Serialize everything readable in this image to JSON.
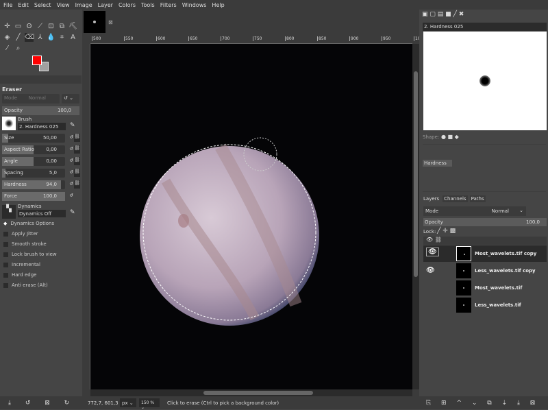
{
  "menu": [
    "File",
    "Edit",
    "Select",
    "View",
    "Image",
    "Layer",
    "Colors",
    "Tools",
    "Filters",
    "Windows",
    "Help"
  ],
  "colors": {
    "fg": "#ff0000",
    "bg": "#a0a0a0"
  },
  "tool_options": {
    "title": "Eraser",
    "mode_label": "Mode",
    "mode_value": "Normal",
    "opacity": {
      "label": "Opacity",
      "value": "100,0",
      "fraction": 1.0
    },
    "brush_label": "Brush",
    "brush_value": "2. Hardness 025",
    "sliders": [
      {
        "label": "Size",
        "value": "50,00",
        "fraction": 0.1
      },
      {
        "label": "Aspect Ratio",
        "value": "0,00",
        "fraction": 0.5
      },
      {
        "label": "Angle",
        "value": "0,00",
        "fraction": 0.5
      },
      {
        "label": "Spacing",
        "value": "5,0",
        "fraction": 0.05
      },
      {
        "label": "Hardness",
        "value": "94,0",
        "fraction": 0.94
      },
      {
        "label": "Force",
        "value": "100,0",
        "fraction": 1.0
      }
    ],
    "dynamics_label": "Dynamics",
    "dynamics_value": "Dynamics Off",
    "dynamics_options": "Dynamics Options",
    "options": [
      "Apply Jitter",
      "Smooth stroke",
      "Lock brush to view",
      "Incremental",
      "Hard edge",
      "Anti erase  (Alt)"
    ]
  },
  "ruler": [
    "500",
    "550",
    "600",
    "650",
    "700",
    "750",
    "800",
    "850",
    "900",
    "950",
    "10"
  ],
  "status": {
    "coords": "772,7, 601,3",
    "unit": "px",
    "zoom": "150 %",
    "message": "Click to erase (Ctrl to pick a background color)"
  },
  "brushes": {
    "title": "2. Hardness 025",
    "shape_label": "Shape:",
    "hardness_label": "Hardness"
  },
  "layers_panel": {
    "tabs": [
      "Layers",
      "Channels",
      "Paths"
    ],
    "mode_label": "Mode",
    "mode_value": "Normal",
    "opacity_label": "Opacity",
    "opacity_value": "100,0",
    "lock_label": "Lock:",
    "layers": [
      {
        "name": "Most_wavelets.tif copy",
        "visible": true,
        "selected": true
      },
      {
        "name": "Less_wavelets.tif copy",
        "visible": true,
        "selected": false
      },
      {
        "name": "Most_wavelets.tif",
        "visible": false,
        "selected": false
      },
      {
        "name": "Less_wavelets.tif",
        "visible": false,
        "selected": false
      }
    ]
  }
}
